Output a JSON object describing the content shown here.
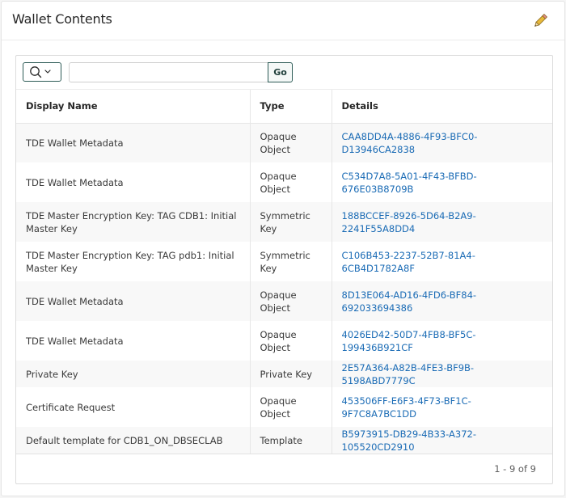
{
  "region": {
    "title": "Wallet Contents",
    "edit_icon": "pencil-icon"
  },
  "toolbar": {
    "search_menu_icon": "magnifier-icon",
    "search_value": "",
    "search_placeholder": "",
    "go_label": "Go"
  },
  "table": {
    "columns": [
      "Display Name",
      "Type",
      "Details"
    ],
    "rows": [
      {
        "name": "TDE Wallet Metadata",
        "type": "Opaque Object",
        "details": "CAA8DD4A-4886-4F93-BFC0-D13946CA2838"
      },
      {
        "name": "TDE Wallet Metadata",
        "type": "Opaque Object",
        "details": "C534D7A8-5A01-4F43-BFBD-676E03B8709B"
      },
      {
        "name": "TDE Master Encryption Key: TAG CDB1: Initial Master Key",
        "type": "Symmetric Key",
        "details": "188BCCEF-8926-5D64-B2A9-2241F55A8DD4"
      },
      {
        "name": "TDE Master Encryption Key: TAG pdb1: Initial Master Key",
        "type": "Symmetric Key",
        "details": "C106B453-2237-52B7-81A4-6CB4D1782A8F"
      },
      {
        "name": "TDE Wallet Metadata",
        "type": "Opaque Object",
        "details": "8D13E064-AD16-4FD6-BF84-692033694386"
      },
      {
        "name": "TDE Wallet Metadata",
        "type": "Opaque Object",
        "details": "4026ED42-50D7-4FB8-BF5C-199436B921CF"
      },
      {
        "name": "Private Key",
        "type": "Private Key",
        "details": "2E57A364-A82B-4FE3-BF9B-5198ABD7779C"
      },
      {
        "name": "Certificate Request",
        "type": "Opaque Object",
        "details": "453506FF-E6F3-4F73-BF1C-9F7C8A7BC1DD"
      },
      {
        "name": "Default template for CDB1_ON_DBSECLAB",
        "type": "Template",
        "details": "B5973915-DB29-4B33-A372-105520CD2910"
      }
    ]
  },
  "footer": {
    "pagination": "1 - 9 of 9"
  },
  "colors": {
    "link": "#1a6bb5",
    "accent_border": "#2e5c57",
    "pencil_body": "#e8b93a"
  }
}
